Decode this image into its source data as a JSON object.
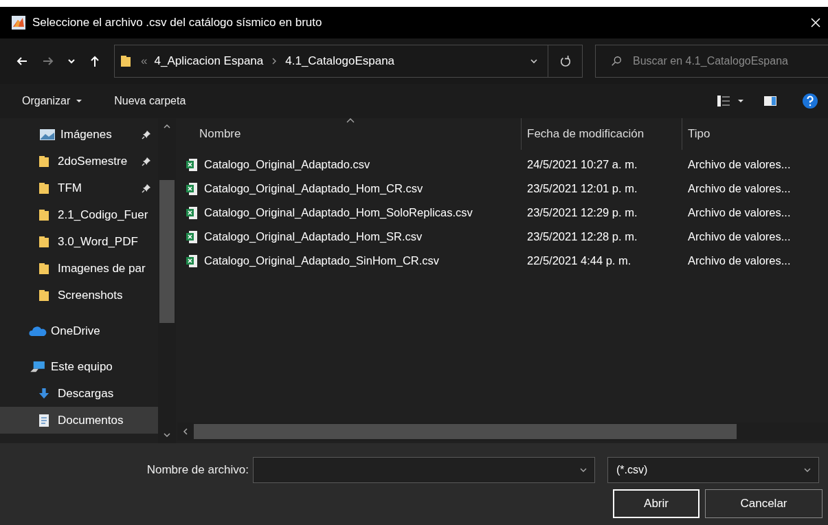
{
  "window": {
    "title": "Seleccione el archivo .csv del catálogo sísmico en bruto"
  },
  "nav": {
    "forward_disabled": true,
    "overflow_mark": "«",
    "breadcrumbs": [
      "4_Aplicacion Espana",
      "4.1_CatalogoEspana"
    ],
    "search": {
      "placeholder": "Buscar en 4.1_CatalogoEspana"
    }
  },
  "command_bar": {
    "organize": "Organizar",
    "new_folder": "Nueva carpeta"
  },
  "sidebar": {
    "items": [
      {
        "kind": "pictures",
        "label": "Imágenes",
        "pinned": true,
        "selected": false
      },
      {
        "kind": "folder",
        "label": "2doSemestre",
        "pinned": true,
        "selected": false
      },
      {
        "kind": "folder",
        "label": "TFM",
        "pinned": true,
        "selected": false
      },
      {
        "kind": "folder",
        "label": "2.1_Codigo_Fuer",
        "pinned": false,
        "selected": false
      },
      {
        "kind": "folder",
        "label": "3.0_Word_PDF",
        "pinned": false,
        "selected": false
      },
      {
        "kind": "folder",
        "label": "Imagenes de par",
        "pinned": false,
        "selected": false
      },
      {
        "kind": "folder",
        "label": "Screenshots",
        "pinned": false,
        "selected": false
      },
      {
        "kind": "cloud",
        "label": "OneDrive",
        "pinned": false,
        "selected": false
      },
      {
        "kind": "computer",
        "label": "Este equipo",
        "pinned": false,
        "selected": false
      },
      {
        "kind": "downloads",
        "label": "Descargas",
        "pinned": false,
        "selected": false
      },
      {
        "kind": "documents",
        "label": "Documentos",
        "pinned": false,
        "selected": true
      }
    ]
  },
  "table": {
    "columns": [
      "Nombre",
      "Fecha de modificación",
      "Tipo"
    ],
    "rows": [
      [
        "Catalogo_Original_Adaptado.csv",
        "24/5/2021 10:27 a. m.",
        "Archivo de valores..."
      ],
      [
        "Catalogo_Original_Adaptado_Hom_CR.csv",
        "23/5/2021 12:01 p. m.",
        "Archivo de valores..."
      ],
      [
        "Catalogo_Original_Adaptado_Hom_SoloReplicas.csv",
        "23/5/2021 12:29 p. m.",
        "Archivo de valores..."
      ],
      [
        "Catalogo_Original_Adaptado_Hom_SR.csv",
        "23/5/2021 12:28 p. m.",
        "Archivo de valores..."
      ],
      [
        "Catalogo_Original_Adaptado_SinHom_CR.csv",
        "22/5/2021 4:44 p. m.",
        "Archivo de valores..."
      ]
    ]
  },
  "footer": {
    "filename_label": "Nombre de archivo:",
    "filter": "(*.csv)",
    "buttons": [
      "Abrir",
      "Cancelar"
    ]
  }
}
